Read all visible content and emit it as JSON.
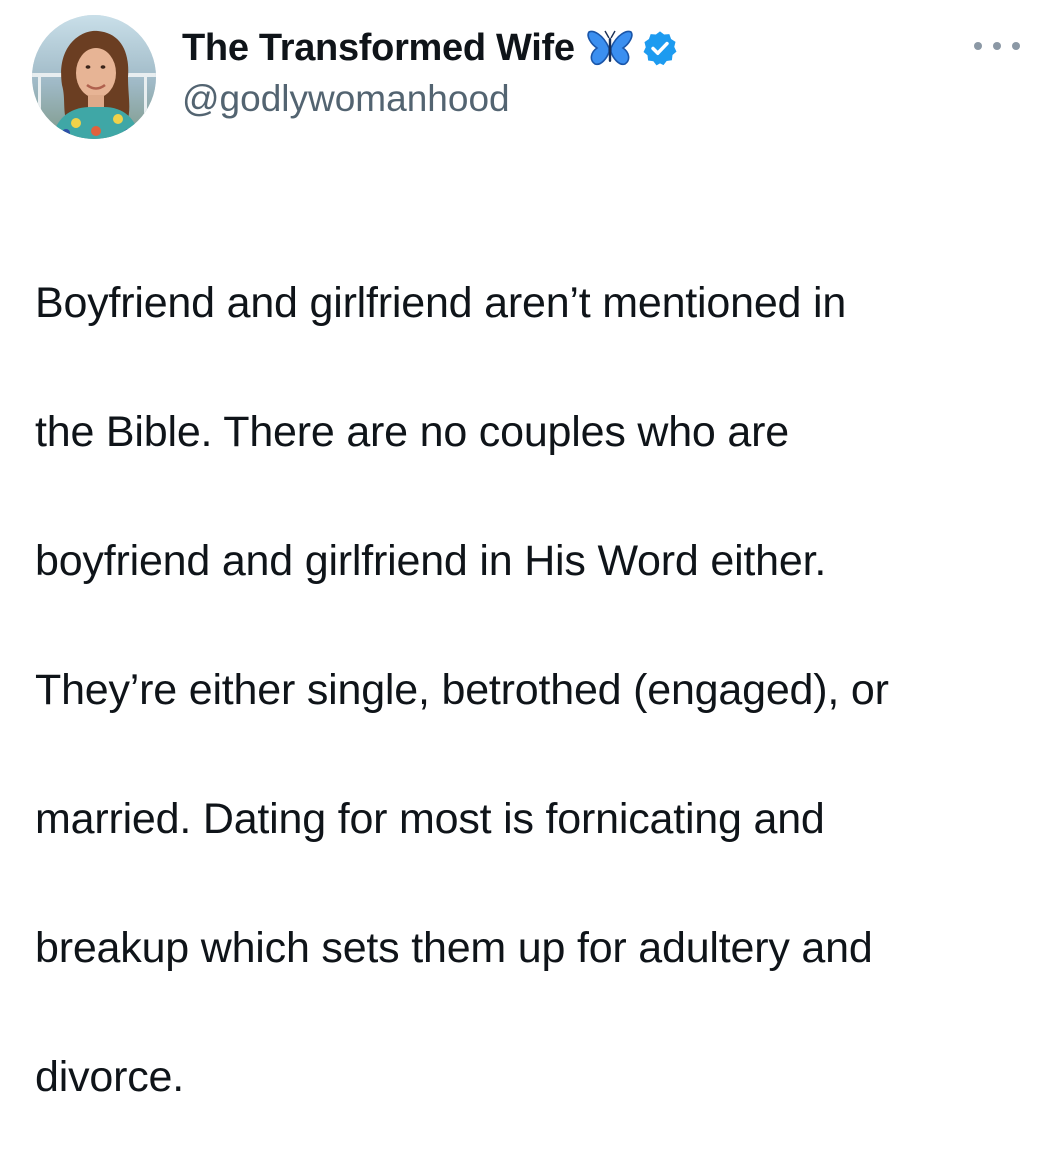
{
  "author": {
    "display_name": "The Transformed Wife",
    "handle": "@godlywomanhood",
    "name_emoji": "butterfly-icon",
    "verified": true,
    "verified_badge_color": "#1d9bf0",
    "avatar": "profile-photo"
  },
  "menu": {
    "more_icon": "more-horizontal-icon"
  },
  "tweet": {
    "text_lines": [
      "Boyfriend and girlfriend aren’t mentioned in",
      "the Bible. There are no couples who are",
      "boyfriend and girlfriend in His Word either.",
      "They’re either single, betrothed (engaged), or",
      "married. Dating for most is fornicating and",
      "breakup which sets them up for adultery and",
      "divorce."
    ]
  },
  "colors": {
    "text_primary": "#0f1419",
    "text_secondary": "#536471",
    "accent": "#1d9bf0",
    "butterfly": "#2a7fe0"
  }
}
